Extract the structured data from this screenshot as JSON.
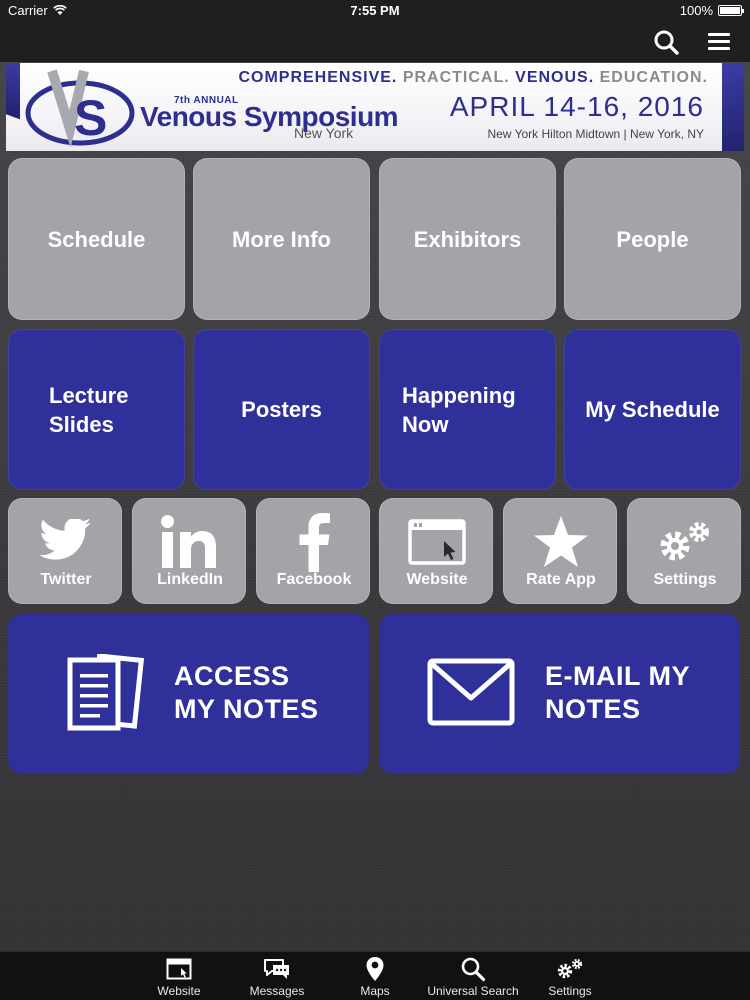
{
  "status_bar": {
    "carrier": "Carrier",
    "time": "7:55 PM",
    "battery": "100%",
    "battery_level": 1.0
  },
  "top_nav": {
    "icons": [
      "search-icon",
      "hamburger-menu-icon"
    ]
  },
  "banner": {
    "logo_letters": "VS",
    "edition": "7th ANNUAL",
    "title": "Venous Symposium",
    "city": "New York",
    "tagline_1": "COMPREHENSIVE.",
    "tagline_2": "PRACTICAL.",
    "tagline_3": "VENOUS.",
    "tagline_4": "EDUCATION.",
    "dates": "APRIL 14-16, 2016",
    "venue": "New York Hilton Midtown  |  New York, NY"
  },
  "tiles_row1": [
    {
      "label": "Schedule"
    },
    {
      "label": "More Info"
    },
    {
      "label": "Exhibitors"
    },
    {
      "label": "People"
    }
  ],
  "tiles_row2": [
    {
      "label_line1": "Lecture",
      "label_line2": "Slides"
    },
    {
      "label": "Posters"
    },
    {
      "label_line1": "Happening",
      "label_line2": "Now"
    },
    {
      "label": "My Schedule"
    }
  ],
  "social_tiles": [
    {
      "label": "Twitter",
      "icon": "twitter-bird-icon"
    },
    {
      "label": "LinkedIn",
      "icon": "linkedin-icon"
    },
    {
      "label": "Facebook",
      "icon": "facebook-icon"
    },
    {
      "label": "Website",
      "icon": "browser-window-icon"
    },
    {
      "label": "Rate App",
      "icon": "star-icon"
    },
    {
      "label": "Settings",
      "icon": "gears-icon"
    }
  ],
  "big_tiles": [
    {
      "line1": "ACCESS",
      "line2": "MY NOTES",
      "icon": "notes-document-icon"
    },
    {
      "line1": "E-MAIL MY",
      "line2": "NOTES",
      "icon": "envelope-icon"
    }
  ],
  "tab_bar": [
    {
      "label": "Website",
      "icon": "browser-window-icon"
    },
    {
      "label": "Messages",
      "icon": "chat-bubbles-icon"
    },
    {
      "label": "Maps",
      "icon": "map-pin-icon"
    },
    {
      "label": "Universal Search",
      "icon": "search-icon"
    },
    {
      "label": "Settings",
      "icon": "gears-icon"
    }
  ],
  "colors": {
    "tile_grey": "#a3a3a8",
    "tile_blue": "#30309a",
    "brand_blue": "#2e2e8e",
    "bar_dark": "#1f1f1f"
  }
}
